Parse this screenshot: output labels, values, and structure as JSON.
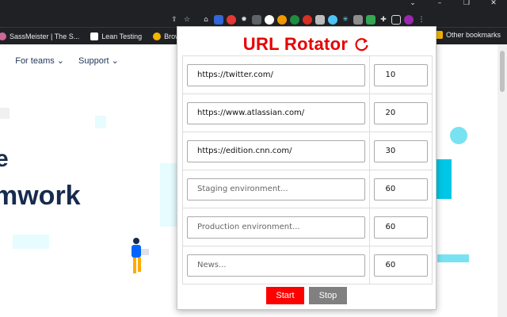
{
  "window": {
    "controls": [
      "⌄",
      "–",
      "❐",
      "✕"
    ]
  },
  "bookmarks": {
    "items": [
      {
        "label": "SassMeister | The S...",
        "color": "#cd6799"
      },
      {
        "label": "Lean Testing",
        "color": "#ffffff"
      },
      {
        "label": "Browse",
        "color": "#f4b400"
      }
    ],
    "other_label": "Other bookmarks"
  },
  "page": {
    "nav": [
      "For teams ⌄",
      "Support ⌄"
    ],
    "hero_line": "mwork",
    "hero_fragment": "e"
  },
  "popup": {
    "title": "URL Rotator",
    "rows": [
      {
        "url": "https://twitter.com/",
        "placeholder": "",
        "time": "10"
      },
      {
        "url": "https://www.atlassian.com/",
        "placeholder": "",
        "time": "20"
      },
      {
        "url": "https://edition.cnn.com/",
        "placeholder": "",
        "time": "30"
      },
      {
        "url": "",
        "placeholder": "Staging environment...",
        "time": "60"
      },
      {
        "url": "",
        "placeholder": "Production environment...",
        "time": "60"
      },
      {
        "url": "",
        "placeholder": "News...",
        "time": "60"
      }
    ],
    "start_label": "Start",
    "stop_label": "Stop"
  },
  "colors": {
    "title": "#e80000",
    "start": "#ff0000",
    "stop": "#808080",
    "chrome": "#202124"
  }
}
